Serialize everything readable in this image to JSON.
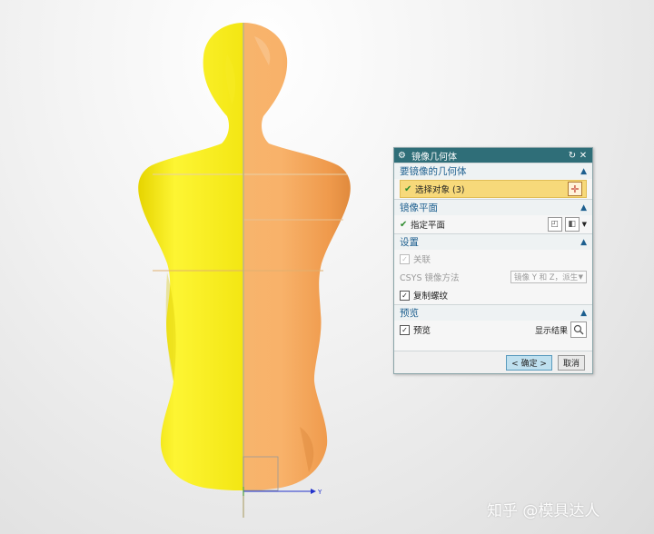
{
  "dialog": {
    "title": "镜像几何体",
    "sections": {
      "geometry": {
        "header": "要镜像的几何体",
        "select_label": "选择对象 (3)"
      },
      "plane": {
        "header": "镜像平面",
        "specify_label": "指定平面"
      },
      "settings": {
        "header": "设置",
        "associative_label": "关联",
        "csys_label": "CSYS 镜像方法",
        "csys_value": "镜像 Y 和 Z，派生",
        "copy_thread_label": "复制螺纹"
      },
      "preview": {
        "header": "预览",
        "preview_label": "预览",
        "show_result_label": "显示结果"
      }
    },
    "ok_label": "< 确定 >",
    "cancel_label": "取消"
  },
  "axis": {
    "y_label": "Y"
  },
  "watermark": "知乎 @模具达人",
  "colors": {
    "yellow_body": "#f2ea19",
    "orange_body": "#f5a85c",
    "title_bar": "#2f6e78",
    "highlight": "#f7d97a",
    "section_header_text": "#1d5f8f"
  },
  "icons": {
    "gear": "gear-icon",
    "reset": "reset-icon",
    "close": "close-icon",
    "chevron": "chevron-up-icon",
    "crosshair": "crosshair-icon",
    "magnifier": "magnifier-icon"
  }
}
